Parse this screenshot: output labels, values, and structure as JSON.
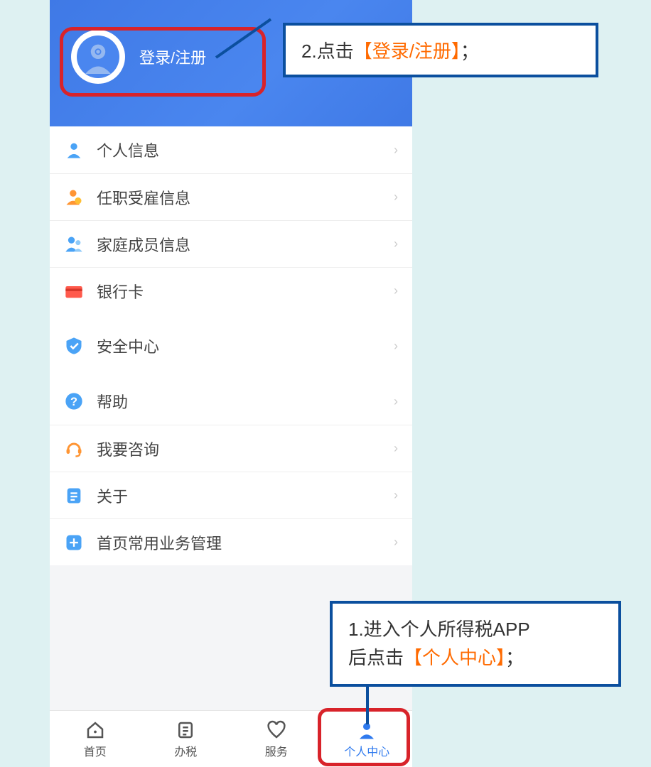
{
  "header": {
    "login_label": "登录/注册"
  },
  "menu": {
    "groups": [
      [
        {
          "label": "个人信息",
          "icon": "person"
        },
        {
          "label": "任职受雇信息",
          "icon": "person-badge"
        },
        {
          "label": "家庭成员信息",
          "icon": "family"
        },
        {
          "label": "银行卡",
          "icon": "card"
        }
      ],
      [
        {
          "label": "安全中心",
          "icon": "shield"
        }
      ],
      [
        {
          "label": "帮助",
          "icon": "help"
        },
        {
          "label": "我要咨询",
          "icon": "headset"
        },
        {
          "label": "关于",
          "icon": "doc"
        },
        {
          "label": "首页常用业务管理",
          "icon": "plus"
        }
      ]
    ]
  },
  "tabbar": {
    "items": [
      {
        "label": "首页",
        "icon": "home"
      },
      {
        "label": "办税",
        "icon": "tax"
      },
      {
        "label": "服务",
        "icon": "service"
      },
      {
        "label": "个人中心",
        "icon": "profile",
        "active": true
      }
    ]
  },
  "callouts": {
    "top": {
      "prefix": "2.点击",
      "highlight": "【登录/注册】",
      "suffix": "；"
    },
    "bottom": {
      "line1_prefix": "1.进入个人所得税APP",
      "line2_prefix": "后点击",
      "highlight": "【个人中心】",
      "suffix": "；"
    }
  }
}
